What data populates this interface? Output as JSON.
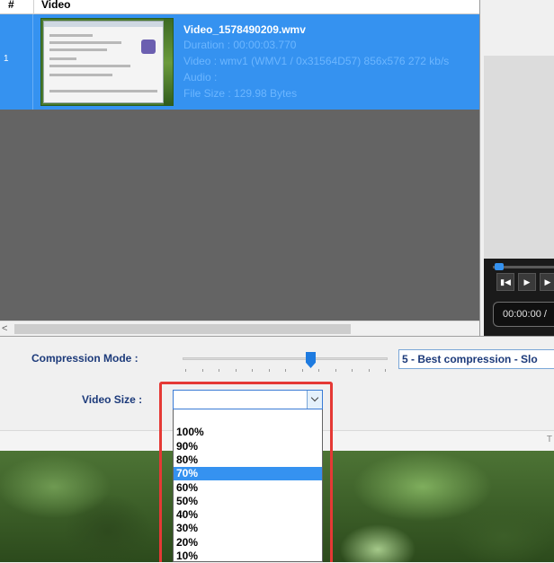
{
  "table": {
    "headers": {
      "index": "#",
      "video": "Video"
    },
    "rows": [
      {
        "index": "1",
        "title": "Video_1578490209.wmv",
        "duration": "Duration : 00:00:03.770",
        "video_info": "Video : wmv1 (WMV1 / 0x31564D57) 856x576 272 kb/s",
        "audio": "Audio :",
        "file_size": "File Size : 129.98 Bytes"
      }
    ],
    "scroll_left_glyph": "<"
  },
  "preview": {
    "time": "00:00:00 /"
  },
  "settings": {
    "compression_label": "Compression Mode :",
    "compression_value": "5 - Best compression - Slo",
    "compression_level": 5,
    "compression_level_max": 6,
    "video_size_label": "Video Size :",
    "video_size_value": "",
    "video_size_options": [
      "",
      "100%",
      "90%",
      "80%",
      "70%",
      "60%",
      "50%",
      "40%",
      "30%",
      "20%",
      "10%"
    ],
    "video_size_selected": "70%",
    "bottom_mark": "T"
  },
  "colors": {
    "selection": "#3592f0",
    "label_text": "#1c3a7a",
    "highlight_border": "#e53935"
  }
}
